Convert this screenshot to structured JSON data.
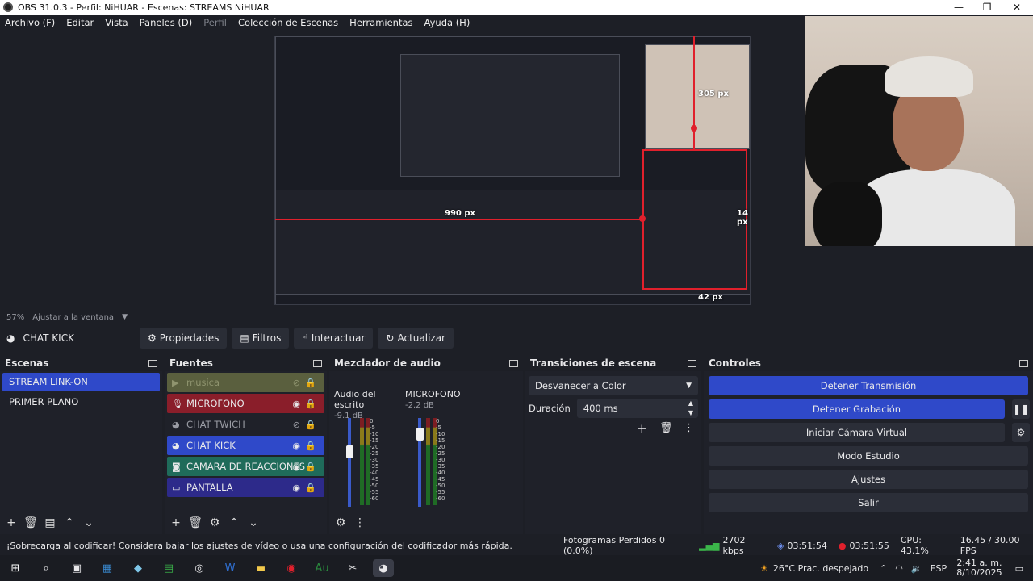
{
  "window": {
    "title": "OBS 31.0.3 - Perfil: NiHUAR - Escenas: STREAMS NiHUAR",
    "minimize": "—",
    "maximize": "❐",
    "close": "✕"
  },
  "menu": {
    "items": [
      "Archivo (F)",
      "Editar",
      "Vista",
      "Paneles (D)",
      "Perfil",
      "Colección de Escenas",
      "Herramientas",
      "Ayuda (H)"
    ]
  },
  "preview": {
    "label_305": "305 px",
    "label_990": "990 px",
    "label_14": "14 px",
    "label_42": "42 px",
    "zoom": "57%",
    "fit_label": "Ajustar a la ventana"
  },
  "source_toolbar": {
    "selected_source": "CHAT KICK",
    "properties": "Propiedades",
    "filters": "Filtros",
    "interact": "Interactuar",
    "refresh": "Actualizar"
  },
  "scenes": {
    "title": "Escenas",
    "items": [
      {
        "label": "STREAM LINK-ON",
        "selected": true
      },
      {
        "label": "PRIMER PLANO",
        "selected": false
      }
    ]
  },
  "sources": {
    "title": "Fuentes",
    "items": [
      {
        "label": "musica",
        "icon": "play-icon",
        "color": "#5a5f3e",
        "hidden": true
      },
      {
        "label": "MICROFONO",
        "icon": "microphone-icon",
        "color": "#8a1e2a",
        "hidden": false
      },
      {
        "label": "CHAT TWICH",
        "icon": "browser-icon",
        "color": "#2a2d36",
        "hidden": true
      },
      {
        "label": "CHAT KICK",
        "icon": "browser-icon",
        "color": "#2f49c9",
        "hidden": false
      },
      {
        "label": "CAMARA DE REACCIONES",
        "icon": "camera-icon",
        "color": "#1f6b5a",
        "hidden": false
      },
      {
        "label": "PANTALLA",
        "icon": "monitor-icon",
        "color": "#2d2a8a",
        "hidden": false
      }
    ]
  },
  "mixer": {
    "title": "Mezclador de audio",
    "channels": [
      {
        "name": "Audio del escrito",
        "db": "-9.1 dB",
        "fader_level": 0.62
      },
      {
        "name": "MICROFONO",
        "db": "-2.2 dB",
        "fader_level": 0.82
      }
    ],
    "scale": [
      "0",
      "-5",
      "-10",
      "-15",
      "-20",
      "-25",
      "-30",
      "-35",
      "-40",
      "-45",
      "-50",
      "-55",
      "-60"
    ]
  },
  "transitions": {
    "title": "Transiciones de escena",
    "selected": "Desvanecer a Color",
    "duration_label": "Duración",
    "duration_value": "400 ms"
  },
  "controls": {
    "title": "Controles",
    "stop_stream": "Detener Transmisión",
    "stop_record": "Detener Grabación",
    "virtual_cam": "Iniciar Cámara Virtual",
    "studio_mode": "Modo Estudio",
    "settings": "Ajustes",
    "exit": "Salir"
  },
  "status": {
    "warning": "¡Sobrecarga al codificar! Considera bajar los ajustes de vídeo o usa una configuración del codificador más rápida.",
    "dropped": "Fotogramas Perdidos 0 (0.0%)",
    "bitrate": "2702 kbps",
    "stream_time": "03:51:54",
    "rec_time": "03:51:55",
    "cpu": "CPU: 43.1%",
    "fps": "16.45 / 30.00 FPS"
  },
  "taskbar": {
    "weather": "26°C  Prac. despejado",
    "lang": "ESP",
    "time": "2:41 a. m.",
    "date": "8/10/2025"
  }
}
